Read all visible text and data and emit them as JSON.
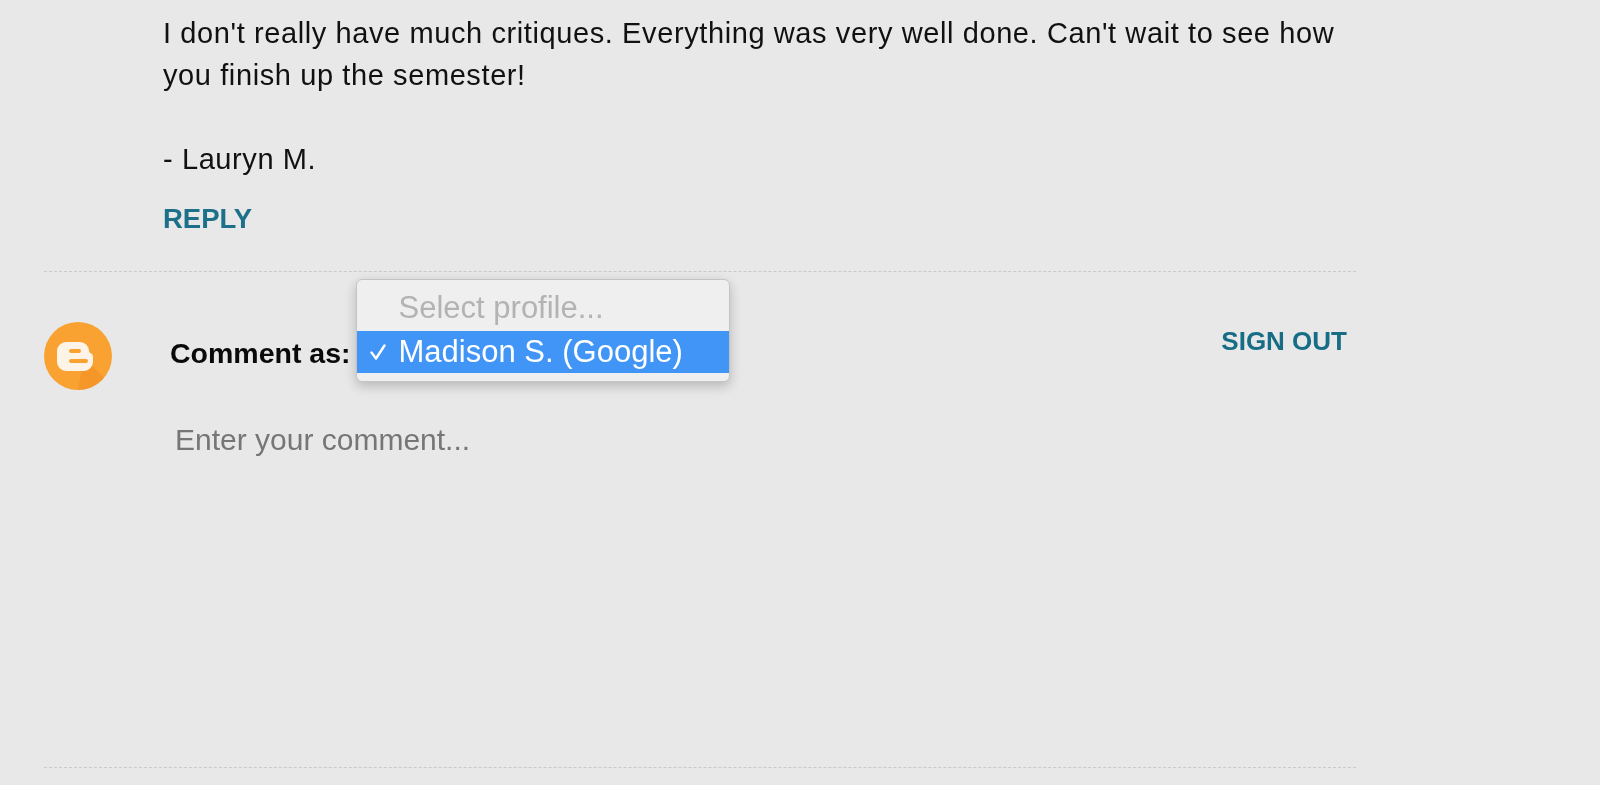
{
  "comment": {
    "paragraphs": [
      "I don't really have much critiques. Everything was very well done. Can't wait to see how you finish up the semester!",
      "- Lauryn M."
    ],
    "reply_link": "REPLY"
  },
  "comment_form": {
    "label": "Comment as:",
    "profile_menu": {
      "options": [
        {
          "label": "Select profile...",
          "disabled": true,
          "selected": false
        },
        {
          "label": "Madison S. (Google)",
          "disabled": false,
          "selected": true
        }
      ]
    },
    "sign_out_link": "SIGN OUT",
    "comment_box": {
      "placeholder": "Enter your comment..."
    }
  }
}
